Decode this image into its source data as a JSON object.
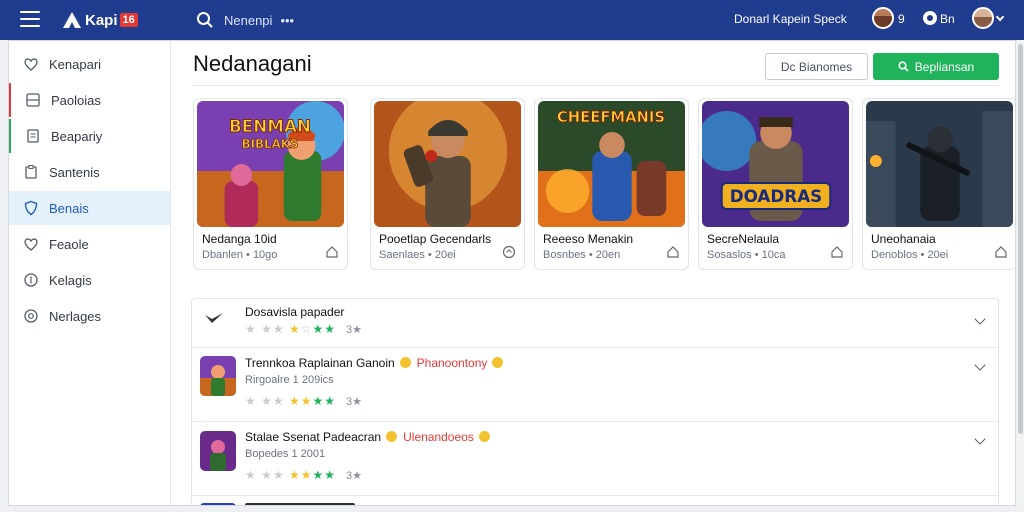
{
  "header": {
    "brand_name": "Kapi",
    "brand_badge": "16",
    "search_text": "Nenenpi",
    "search_more": "•••",
    "link_text": "Donarl Kapein Speck",
    "counter": "9",
    "lang": "Bn"
  },
  "sidebar": {
    "items": [
      {
        "label": "Kenapari",
        "icon": "heart-icon"
      },
      {
        "label": "Paoloias",
        "icon": "grid-icon"
      },
      {
        "label": "Beapariy",
        "icon": "document-icon"
      },
      {
        "label": "Santenis",
        "icon": "clipboard-icon"
      },
      {
        "label": "Benais",
        "icon": "shield-icon"
      },
      {
        "label": "Feaole",
        "icon": "heart-icon"
      },
      {
        "label": "Kelagis",
        "icon": "coin-icon"
      },
      {
        "label": "Nerlages",
        "icon": "target-icon"
      }
    ],
    "active_index": 4
  },
  "main": {
    "title": "Nedanagani",
    "outline_button": "Dc Bianomes",
    "green_button": "Bepliansan"
  },
  "cards": [
    {
      "title": "Nedanga 10id",
      "sub": "Dbanlen • 10go",
      "art_text": "BENMAN\nBIBLAKS"
    },
    {
      "title": "Pooetlap Gecendarls",
      "sub": "Saenlaes • 20ei",
      "art_text": ""
    },
    {
      "title": "Reeeso Menakin",
      "sub": "Bosnbes • 20en",
      "art_text": "CHEEFMANIS"
    },
    {
      "title": "SecreNelaula",
      "sub": "Sosaslos • 10ca",
      "art_text": "DOADRAS"
    },
    {
      "title": "Uneohanaia",
      "sub": "Denoblos • 20ei",
      "art_text": ""
    }
  ],
  "list": {
    "rows": [
      {
        "title": "Dosavisla papader",
        "tag": "",
        "sub": "",
        "star_count": "3★"
      },
      {
        "title": "Trennkoa Raplainan Ganoin",
        "tag": "Phanoontony",
        "sub": "Rirgoalre 1 209ics",
        "star_count": "3★"
      },
      {
        "title": "Stalae Ssenat Padeacran",
        "tag": "Ulenandoeos",
        "sub": "Bopedes 1 2001",
        "star_count": "3★"
      }
    ]
  },
  "colors": {
    "topbar": "#1f3c8f",
    "accent_green": "#1fb35c",
    "accent_red": "#e53935",
    "active_bg": "#e4f0fb"
  }
}
